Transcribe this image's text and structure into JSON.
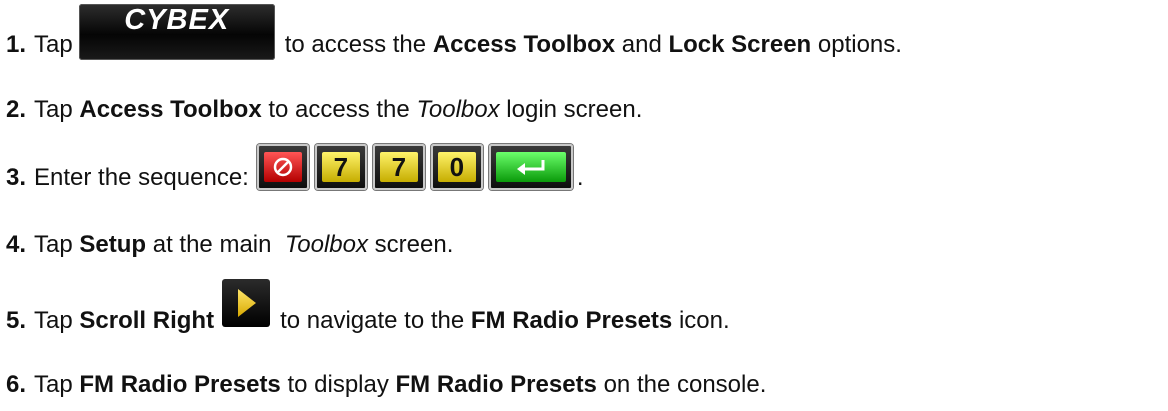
{
  "steps": [
    {
      "num": "1.",
      "t1": "Tap",
      "t2": "to access the",
      "b1": "Access Toolbox",
      "t3": "and",
      "b2": "Lock Screen",
      "t4": "options."
    },
    {
      "num": "2.",
      "t1": "Tap",
      "b1": "Access Toolbox",
      "t2": "to access the",
      "i1": "Toolbox",
      "t3": "login screen."
    },
    {
      "num": "3.",
      "t1": "Enter the sequence:",
      "t2": "."
    },
    {
      "num": "4.",
      "t1": "Tap",
      "b1": "Setup",
      "t2": "at the main",
      "i1": "Toolbox",
      "t3": "screen."
    },
    {
      "num": "5.",
      "t1": "Tap",
      "b1": "Scroll Right",
      "t2": "to navigate to the",
      "b2": "FM Radio Presets",
      "t3": "icon."
    },
    {
      "num": "6.",
      "t1": "Tap",
      "b1": "FM Radio Presets",
      "t2": "to display",
      "b2": "FM Radio Presets",
      "t3": "on the console."
    }
  ],
  "cybex_logo": "CYBEX",
  "sequence_keys": [
    "7",
    "7",
    "0"
  ],
  "icons": {
    "clear": "clear-icon",
    "enter": "enter-arrow-icon",
    "scroll_right": "play-triangle-icon"
  },
  "colors": {
    "clear_key": "#e00000",
    "digit_key": "#f2e21a",
    "enter_key": "#2fd42f"
  }
}
